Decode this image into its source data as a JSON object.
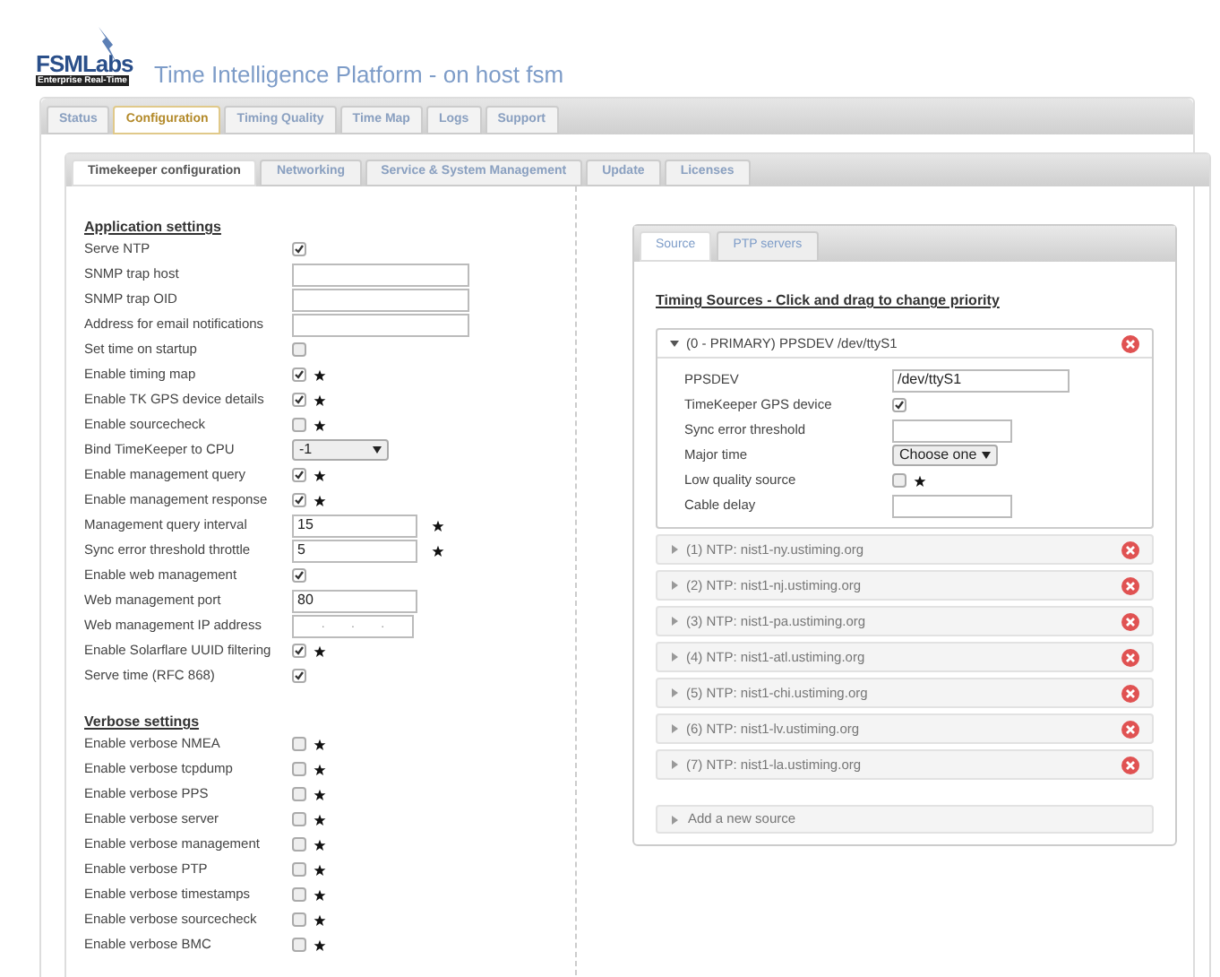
{
  "header": {
    "logo": "FSMLabs",
    "logo_tagline": "Enterprise Real-Time",
    "title": "Time Intelligence Platform - on host fsm"
  },
  "tabs": [
    {
      "label": "Status",
      "selected": false
    },
    {
      "label": "Configuration",
      "selected": true
    },
    {
      "label": "Timing Quality",
      "selected": false
    },
    {
      "label": "Time Map",
      "selected": false
    },
    {
      "label": "Logs",
      "selected": false
    },
    {
      "label": "Support",
      "selected": false
    }
  ],
  "subtabs": [
    {
      "label": "Timekeeper configuration",
      "selected": true
    },
    {
      "label": "Networking",
      "selected": false
    },
    {
      "label": "Service & System Management",
      "selected": false
    },
    {
      "label": "Update",
      "selected": false
    },
    {
      "label": "Licenses",
      "selected": false
    }
  ],
  "sections": [
    {
      "title": "Application settings",
      "rows": [
        {
          "label": "Serve NTP",
          "kind": "checkbox",
          "checked": true,
          "star": false
        },
        {
          "label": "SNMP trap host",
          "kind": "text",
          "wide": true,
          "star": false
        },
        {
          "label": "SNMP trap OID",
          "kind": "text",
          "wide": true,
          "star": false
        },
        {
          "label": "Address for email notifications",
          "kind": "text",
          "wide": true,
          "star": false
        },
        {
          "label": "Set time on startup",
          "kind": "checkbox",
          "checked": false,
          "star": false
        },
        {
          "label": "Enable timing map",
          "kind": "checkbox",
          "checked": true,
          "star": true
        },
        {
          "label": "Enable TK GPS device details",
          "kind": "checkbox",
          "checked": true,
          "star": true
        },
        {
          "label": "Enable sourcecheck",
          "kind": "checkbox",
          "checked": false,
          "star": true
        },
        {
          "label": "Bind TimeKeeper to CPU",
          "kind": "select",
          "value": "-1",
          "star": false
        },
        {
          "label": "Enable management query",
          "kind": "checkbox",
          "checked": true,
          "star": true
        },
        {
          "label": "Enable management response",
          "kind": "checkbox",
          "checked": true,
          "star": true
        },
        {
          "label": "Management query interval",
          "kind": "text",
          "wide": false,
          "value": "15",
          "star": true
        },
        {
          "label": "Sync error threshold throttle",
          "kind": "text",
          "wide": false,
          "value": "5",
          "star": true
        },
        {
          "label": "Enable web management",
          "kind": "checkbox",
          "checked": true,
          "star": false
        },
        {
          "label": "Web management port",
          "kind": "text",
          "wide": false,
          "value": "80",
          "star": false
        },
        {
          "label": "Web management IP address",
          "kind": "ip",
          "separators": [
            ".",
            ".",
            "."
          ],
          "star": false
        },
        {
          "label": "Enable Solarflare UUID filtering",
          "kind": "checkbox",
          "checked": true,
          "star": true
        },
        {
          "label": "Serve time (RFC 868)",
          "kind": "checkbox",
          "checked": true,
          "star": false
        }
      ]
    },
    {
      "title": "Verbose settings",
      "rows": [
        {
          "label": "Enable verbose NMEA",
          "kind": "checkbox",
          "checked": false,
          "star": true
        },
        {
          "label": "Enable verbose tcpdump",
          "kind": "checkbox",
          "checked": false,
          "star": true
        },
        {
          "label": "Enable verbose PPS",
          "kind": "checkbox",
          "checked": false,
          "star": true
        },
        {
          "label": "Enable verbose server",
          "kind": "checkbox",
          "checked": false,
          "star": true
        },
        {
          "label": "Enable verbose management",
          "kind": "checkbox",
          "checked": false,
          "star": true
        },
        {
          "label": "Enable verbose PTP",
          "kind": "checkbox",
          "checked": false,
          "star": true
        },
        {
          "label": "Enable verbose timestamps",
          "kind": "checkbox",
          "checked": false,
          "star": true
        },
        {
          "label": "Enable verbose sourcecheck",
          "kind": "checkbox",
          "checked": false,
          "star": true
        },
        {
          "label": "Enable verbose BMC",
          "kind": "checkbox",
          "checked": false,
          "star": true
        }
      ]
    }
  ],
  "source_panel": {
    "tabs": [
      {
        "label": "Source",
        "selected": true
      },
      {
        "label": "PTP servers",
        "selected": false
      }
    ],
    "heading": "Timing Sources - Click and drag to change priority",
    "sources": [
      {
        "label": "(0 - PRIMARY) PPSDEV /dev/ttyS1",
        "expanded": true,
        "fields": [
          {
            "label": "PPSDEV",
            "kind": "text",
            "wide": true,
            "value": "/dev/ttyS1",
            "star": false
          },
          {
            "label": "TimeKeeper GPS device",
            "kind": "checkbox",
            "checked": true,
            "star": false
          },
          {
            "label": "Sync error threshold",
            "kind": "text",
            "wide": false,
            "star": false
          },
          {
            "label": "Major time",
            "kind": "select",
            "value": "Choose one",
            "star": false
          },
          {
            "label": "Low quality source",
            "kind": "checkbox",
            "checked": false,
            "star": true
          },
          {
            "label": "Cable delay",
            "kind": "text",
            "wide": false,
            "star": false
          }
        ]
      },
      {
        "label": "(1) NTP: nist1-ny.ustiming.org",
        "expanded": false
      },
      {
        "label": "(2) NTP: nist1-nj.ustiming.org",
        "expanded": false
      },
      {
        "label": "(3) NTP: nist1-pa.ustiming.org",
        "expanded": false
      },
      {
        "label": "(4) NTP: nist1-atl.ustiming.org",
        "expanded": false
      },
      {
        "label": "(5) NTP: nist1-chi.ustiming.org",
        "expanded": false
      },
      {
        "label": "(6) NTP: nist1-lv.ustiming.org",
        "expanded": false
      },
      {
        "label": "(7) NTP: nist1-la.ustiming.org",
        "expanded": false
      }
    ],
    "add_source": "Add a new source"
  }
}
